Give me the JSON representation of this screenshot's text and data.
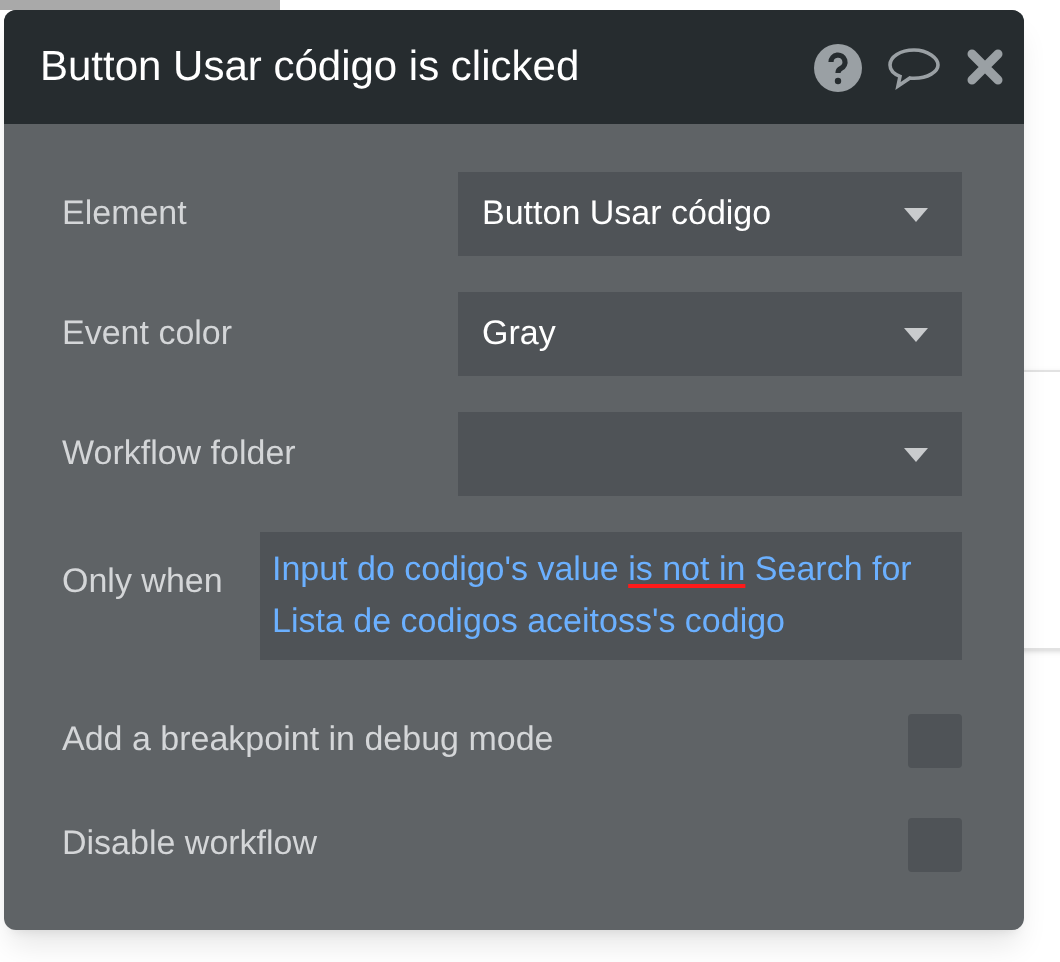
{
  "header": {
    "title": "Button Usar código is clicked"
  },
  "fields": [
    {
      "label": "Element",
      "value": "Button Usar código"
    },
    {
      "label": "Event color",
      "value": "Gray"
    },
    {
      "label": "Workflow folder"
    }
  ],
  "condition": {
    "label": "Only when",
    "parts": [
      {
        "text": "Input do codigo's value ",
        "error": false
      },
      {
        "text": "is not in",
        "error": true
      },
      {
        "text": " Search for Lista de codigos aceitoss's codigo",
        "error": false
      }
    ]
  },
  "options": [
    {
      "label": "Add a breakpoint in debug mode",
      "checked": false
    },
    {
      "label": "Disable workflow",
      "checked": false
    }
  ]
}
